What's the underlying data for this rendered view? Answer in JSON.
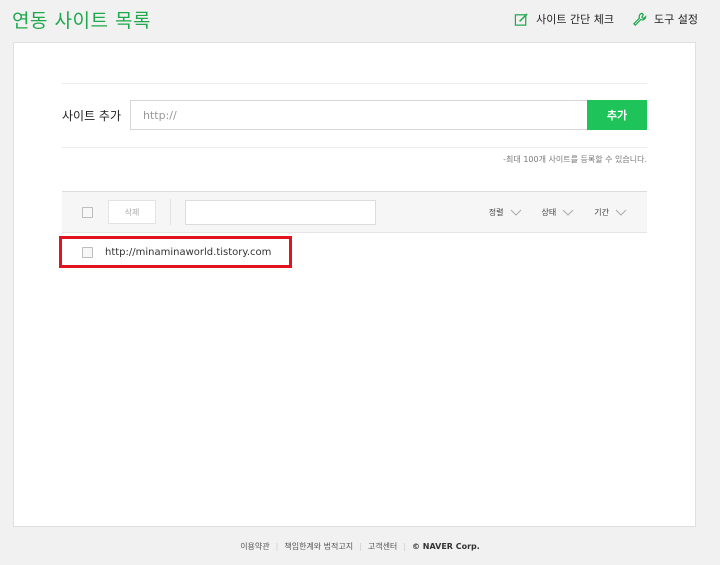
{
  "header": {
    "title": "연동 사이트 목록",
    "actions": [
      {
        "label": "사이트 간단 체크",
        "icon": "edit-icon"
      },
      {
        "label": "도구 설정",
        "icon": "wrench-icon"
      }
    ]
  },
  "add_site": {
    "label": "사이트 추가",
    "placeholder": "http://",
    "button_label": "추가",
    "limit_note": "-최대 100개 사이트를 등록할 수 있습니다."
  },
  "toolbar": {
    "delete_label": "삭제",
    "search_value": "",
    "filters": [
      {
        "label": "정렬"
      },
      {
        "label": "상태"
      },
      {
        "label": "기간"
      }
    ]
  },
  "sites": [
    {
      "url": "http://minaminaworld.tistory.com",
      "checked": false
    }
  ],
  "footer": {
    "links": [
      "이용약관",
      "책임한계와 법적고지",
      "고객센터"
    ],
    "brand": "© NAVER Corp."
  },
  "colors": {
    "accent": "#1ec35a",
    "title": "#1fa84c",
    "highlight": "#e0141e"
  }
}
